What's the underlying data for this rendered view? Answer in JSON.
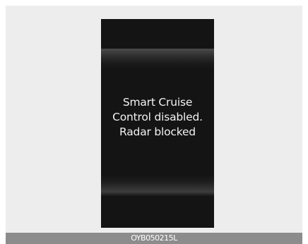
{
  "cluster_display": {
    "message_lines": [
      "Smart Cruise",
      "Control disabled.",
      "Radar blocked"
    ]
  },
  "figure": {
    "code": "OYB050215L"
  }
}
